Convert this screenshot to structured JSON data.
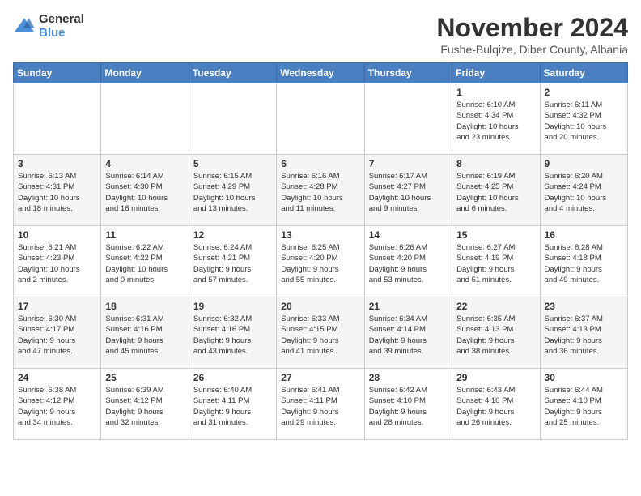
{
  "header": {
    "logo_general": "General",
    "logo_blue": "Blue",
    "month_title": "November 2024",
    "subtitle": "Fushe-Bulqize, Diber County, Albania"
  },
  "weekdays": [
    "Sunday",
    "Monday",
    "Tuesday",
    "Wednesday",
    "Thursday",
    "Friday",
    "Saturday"
  ],
  "weeks": [
    [
      {
        "day": "",
        "info": ""
      },
      {
        "day": "",
        "info": ""
      },
      {
        "day": "",
        "info": ""
      },
      {
        "day": "",
        "info": ""
      },
      {
        "day": "",
        "info": ""
      },
      {
        "day": "1",
        "info": "Sunrise: 6:10 AM\nSunset: 4:34 PM\nDaylight: 10 hours\nand 23 minutes."
      },
      {
        "day": "2",
        "info": "Sunrise: 6:11 AM\nSunset: 4:32 PM\nDaylight: 10 hours\nand 20 minutes."
      }
    ],
    [
      {
        "day": "3",
        "info": "Sunrise: 6:13 AM\nSunset: 4:31 PM\nDaylight: 10 hours\nand 18 minutes."
      },
      {
        "day": "4",
        "info": "Sunrise: 6:14 AM\nSunset: 4:30 PM\nDaylight: 10 hours\nand 16 minutes."
      },
      {
        "day": "5",
        "info": "Sunrise: 6:15 AM\nSunset: 4:29 PM\nDaylight: 10 hours\nand 13 minutes."
      },
      {
        "day": "6",
        "info": "Sunrise: 6:16 AM\nSunset: 4:28 PM\nDaylight: 10 hours\nand 11 minutes."
      },
      {
        "day": "7",
        "info": "Sunrise: 6:17 AM\nSunset: 4:27 PM\nDaylight: 10 hours\nand 9 minutes."
      },
      {
        "day": "8",
        "info": "Sunrise: 6:19 AM\nSunset: 4:25 PM\nDaylight: 10 hours\nand 6 minutes."
      },
      {
        "day": "9",
        "info": "Sunrise: 6:20 AM\nSunset: 4:24 PM\nDaylight: 10 hours\nand 4 minutes."
      }
    ],
    [
      {
        "day": "10",
        "info": "Sunrise: 6:21 AM\nSunset: 4:23 PM\nDaylight: 10 hours\nand 2 minutes."
      },
      {
        "day": "11",
        "info": "Sunrise: 6:22 AM\nSunset: 4:22 PM\nDaylight: 10 hours\nand 0 minutes."
      },
      {
        "day": "12",
        "info": "Sunrise: 6:24 AM\nSunset: 4:21 PM\nDaylight: 9 hours\nand 57 minutes."
      },
      {
        "day": "13",
        "info": "Sunrise: 6:25 AM\nSunset: 4:20 PM\nDaylight: 9 hours\nand 55 minutes."
      },
      {
        "day": "14",
        "info": "Sunrise: 6:26 AM\nSunset: 4:20 PM\nDaylight: 9 hours\nand 53 minutes."
      },
      {
        "day": "15",
        "info": "Sunrise: 6:27 AM\nSunset: 4:19 PM\nDaylight: 9 hours\nand 51 minutes."
      },
      {
        "day": "16",
        "info": "Sunrise: 6:28 AM\nSunset: 4:18 PM\nDaylight: 9 hours\nand 49 minutes."
      }
    ],
    [
      {
        "day": "17",
        "info": "Sunrise: 6:30 AM\nSunset: 4:17 PM\nDaylight: 9 hours\nand 47 minutes."
      },
      {
        "day": "18",
        "info": "Sunrise: 6:31 AM\nSunset: 4:16 PM\nDaylight: 9 hours\nand 45 minutes."
      },
      {
        "day": "19",
        "info": "Sunrise: 6:32 AM\nSunset: 4:16 PM\nDaylight: 9 hours\nand 43 minutes."
      },
      {
        "day": "20",
        "info": "Sunrise: 6:33 AM\nSunset: 4:15 PM\nDaylight: 9 hours\nand 41 minutes."
      },
      {
        "day": "21",
        "info": "Sunrise: 6:34 AM\nSunset: 4:14 PM\nDaylight: 9 hours\nand 39 minutes."
      },
      {
        "day": "22",
        "info": "Sunrise: 6:35 AM\nSunset: 4:13 PM\nDaylight: 9 hours\nand 38 minutes."
      },
      {
        "day": "23",
        "info": "Sunrise: 6:37 AM\nSunset: 4:13 PM\nDaylight: 9 hours\nand 36 minutes."
      }
    ],
    [
      {
        "day": "24",
        "info": "Sunrise: 6:38 AM\nSunset: 4:12 PM\nDaylight: 9 hours\nand 34 minutes."
      },
      {
        "day": "25",
        "info": "Sunrise: 6:39 AM\nSunset: 4:12 PM\nDaylight: 9 hours\nand 32 minutes."
      },
      {
        "day": "26",
        "info": "Sunrise: 6:40 AM\nSunset: 4:11 PM\nDaylight: 9 hours\nand 31 minutes."
      },
      {
        "day": "27",
        "info": "Sunrise: 6:41 AM\nSunset: 4:11 PM\nDaylight: 9 hours\nand 29 minutes."
      },
      {
        "day": "28",
        "info": "Sunrise: 6:42 AM\nSunset: 4:10 PM\nDaylight: 9 hours\nand 28 minutes."
      },
      {
        "day": "29",
        "info": "Sunrise: 6:43 AM\nSunset: 4:10 PM\nDaylight: 9 hours\nand 26 minutes."
      },
      {
        "day": "30",
        "info": "Sunrise: 6:44 AM\nSunset: 4:10 PM\nDaylight: 9 hours\nand 25 minutes."
      }
    ]
  ]
}
